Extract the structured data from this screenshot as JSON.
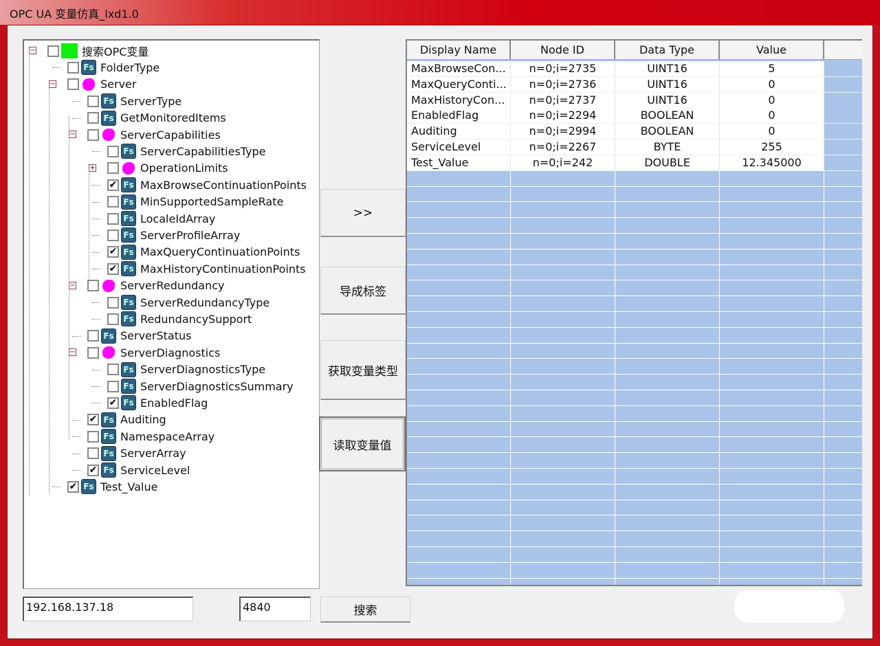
{
  "window": {
    "title": "OPC UA 变量仿真_lxd1.0"
  },
  "tree": [
    {
      "level": 0,
      "exp": "minus",
      "checked": false,
      "icon": "green",
      "label": "搜索OPC变量"
    },
    {
      "level": 1,
      "exp": "",
      "checked": false,
      "icon": "fs",
      "label": "FolderType"
    },
    {
      "level": 1,
      "exp": "minus",
      "checked": false,
      "icon": "pink",
      "label": "Server"
    },
    {
      "level": 2,
      "exp": "",
      "checked": false,
      "icon": "fs",
      "label": "ServerType"
    },
    {
      "level": 2,
      "exp": "",
      "checked": false,
      "icon": "fs",
      "label": "GetMonitoredItems"
    },
    {
      "level": 2,
      "exp": "minus",
      "checked": false,
      "icon": "pink",
      "label": "ServerCapabilities"
    },
    {
      "level": 3,
      "exp": "",
      "checked": false,
      "icon": "fs",
      "label": "ServerCapabilitiesType"
    },
    {
      "level": 3,
      "exp": "plus",
      "checked": false,
      "icon": "pink",
      "label": "OperationLimits"
    },
    {
      "level": 3,
      "exp": "",
      "checked": true,
      "icon": "fs",
      "label": "MaxBrowseContinuationPoints"
    },
    {
      "level": 3,
      "exp": "",
      "checked": false,
      "icon": "fs",
      "label": "MinSupportedSampleRate"
    },
    {
      "level": 3,
      "exp": "",
      "checked": false,
      "icon": "fs",
      "label": "LocaleIdArray"
    },
    {
      "level": 3,
      "exp": "",
      "checked": false,
      "icon": "fs",
      "label": "ServerProfileArray"
    },
    {
      "level": 3,
      "exp": "",
      "checked": true,
      "icon": "fs",
      "label": "MaxQueryContinuationPoints"
    },
    {
      "level": 3,
      "exp": "",
      "checked": true,
      "icon": "fs",
      "label": "MaxHistoryContinuationPoints"
    },
    {
      "level": 2,
      "exp": "minus",
      "checked": false,
      "icon": "pink",
      "label": "ServerRedundancy"
    },
    {
      "level": 3,
      "exp": "",
      "checked": false,
      "icon": "fs",
      "label": "ServerRedundancyType"
    },
    {
      "level": 3,
      "exp": "",
      "checked": false,
      "icon": "fs",
      "label": "RedundancySupport"
    },
    {
      "level": 2,
      "exp": "",
      "checked": false,
      "icon": "fs",
      "label": "ServerStatus"
    },
    {
      "level": 2,
      "exp": "minus",
      "checked": false,
      "icon": "pink",
      "label": "ServerDiagnostics"
    },
    {
      "level": 3,
      "exp": "",
      "checked": false,
      "icon": "fs",
      "label": "ServerDiagnosticsType"
    },
    {
      "level": 3,
      "exp": "",
      "checked": false,
      "icon": "fs",
      "label": "ServerDiagnosticsSummary"
    },
    {
      "level": 3,
      "exp": "",
      "checked": true,
      "icon": "fs",
      "label": "EnabledFlag"
    },
    {
      "level": 2,
      "exp": "",
      "checked": true,
      "icon": "fs",
      "label": "Auditing"
    },
    {
      "level": 2,
      "exp": "",
      "checked": false,
      "icon": "fs",
      "label": "NamespaceArray"
    },
    {
      "level": 2,
      "exp": "",
      "checked": false,
      "icon": "fs",
      "label": "ServerArray"
    },
    {
      "level": 2,
      "exp": "",
      "checked": true,
      "icon": "fs",
      "label": "ServiceLevel"
    },
    {
      "level": 1,
      "exp": "",
      "checked": true,
      "icon": "fs",
      "label": "Test_Value"
    }
  ],
  "icon_text": "Fs",
  "buttons": {
    "add": ">>",
    "export": "导成标签",
    "get_type": "获取变量类型",
    "read_value": "读取变量值",
    "search": "搜索"
  },
  "table": {
    "columns": [
      "Display Name",
      "Node ID",
      "Data Type",
      "Value",
      ""
    ],
    "rows": [
      [
        "MaxBrowseCon...",
        "n=0;i=2735",
        "UINT16",
        "5"
      ],
      [
        "MaxQueryConti...",
        "n=0;i=2736",
        "UINT16",
        "0"
      ],
      [
        "MaxHistoryCon...",
        "n=0;i=2737",
        "UINT16",
        "0"
      ],
      [
        "EnabledFlag",
        "n=0;i=2294",
        "BOOLEAN",
        "0"
      ],
      [
        "Auditing",
        "n=0;i=2994",
        "BOOLEAN",
        "0"
      ],
      [
        "ServiceLevel",
        "n=0;i=2267",
        "BYTE",
        "255"
      ],
      [
        "Test_Value",
        "n=0;i=242",
        "DOUBLE",
        "12.345000"
      ]
    ],
    "empty_rows": 27
  },
  "connection": {
    "ip": "192.168.137.18",
    "port": "4840"
  }
}
